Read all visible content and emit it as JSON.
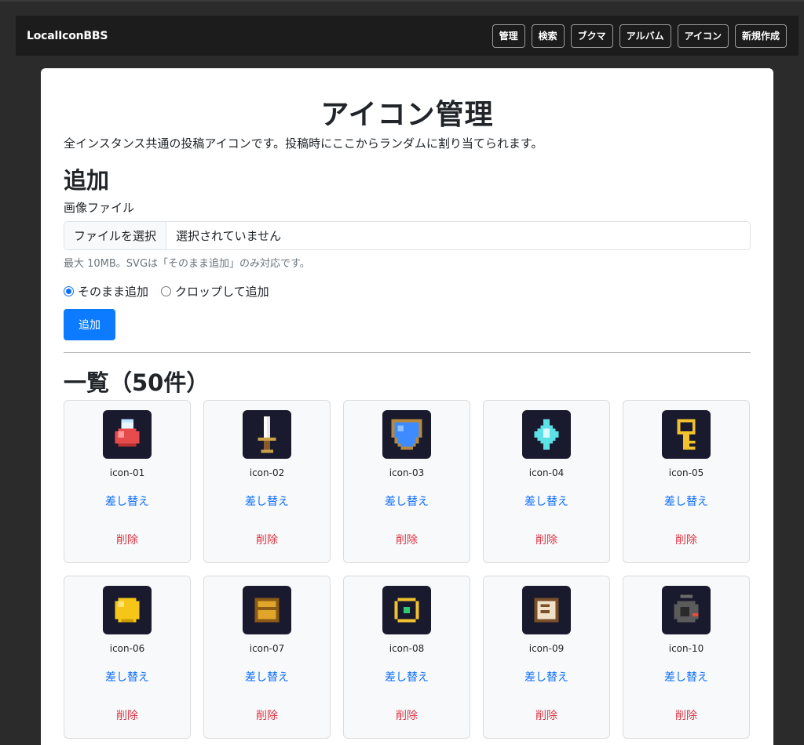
{
  "navbar": {
    "brand": "LocalIconBBS",
    "links": [
      "管理",
      "検索",
      "ブクマ",
      "アルバム",
      "アイコン",
      "新規作成"
    ]
  },
  "page": {
    "title": "アイコン管理",
    "lead": "全インスタンス共通の投稿アイコンです。投稿時にここからランダムに割り当てられます。"
  },
  "add_section": {
    "heading": "追加",
    "file_label": "画像ファイル",
    "file_button": "ファイルを選択",
    "file_status": "選択されていません",
    "hint": "最大 10MB。SVGは「そのまま追加」のみ対応です。",
    "mode_options": [
      {
        "label": "そのまま追加",
        "checked": true
      },
      {
        "label": "クロップして追加",
        "checked": false
      }
    ],
    "submit_label": "追加"
  },
  "list_section": {
    "heading": "一覧（50件）",
    "replace_label": "差し替え",
    "delete_label": "削除",
    "icons": [
      {
        "name": "icon-01",
        "depicts": "potion-icon"
      },
      {
        "name": "icon-02",
        "depicts": "sword-icon"
      },
      {
        "name": "icon-03",
        "depicts": "shield-icon"
      },
      {
        "name": "icon-04",
        "depicts": "crystal-icon"
      },
      {
        "name": "icon-05",
        "depicts": "key-icon"
      },
      {
        "name": "icon-06",
        "depicts": "coin-icon"
      },
      {
        "name": "icon-07",
        "depicts": "chest-icon"
      },
      {
        "name": "icon-08",
        "depicts": "ring-icon"
      },
      {
        "name": "icon-09",
        "depicts": "scroll-icon"
      },
      {
        "name": "icon-10",
        "depicts": "bomb-icon"
      }
    ]
  },
  "colors": {
    "page_bg": "#2b2b2b",
    "navbar_bg": "#1c1c1c",
    "primary": "#0d7bff",
    "link": "#0d6efd",
    "danger": "#dc3545",
    "icon_bg": "#1a1a2e"
  }
}
